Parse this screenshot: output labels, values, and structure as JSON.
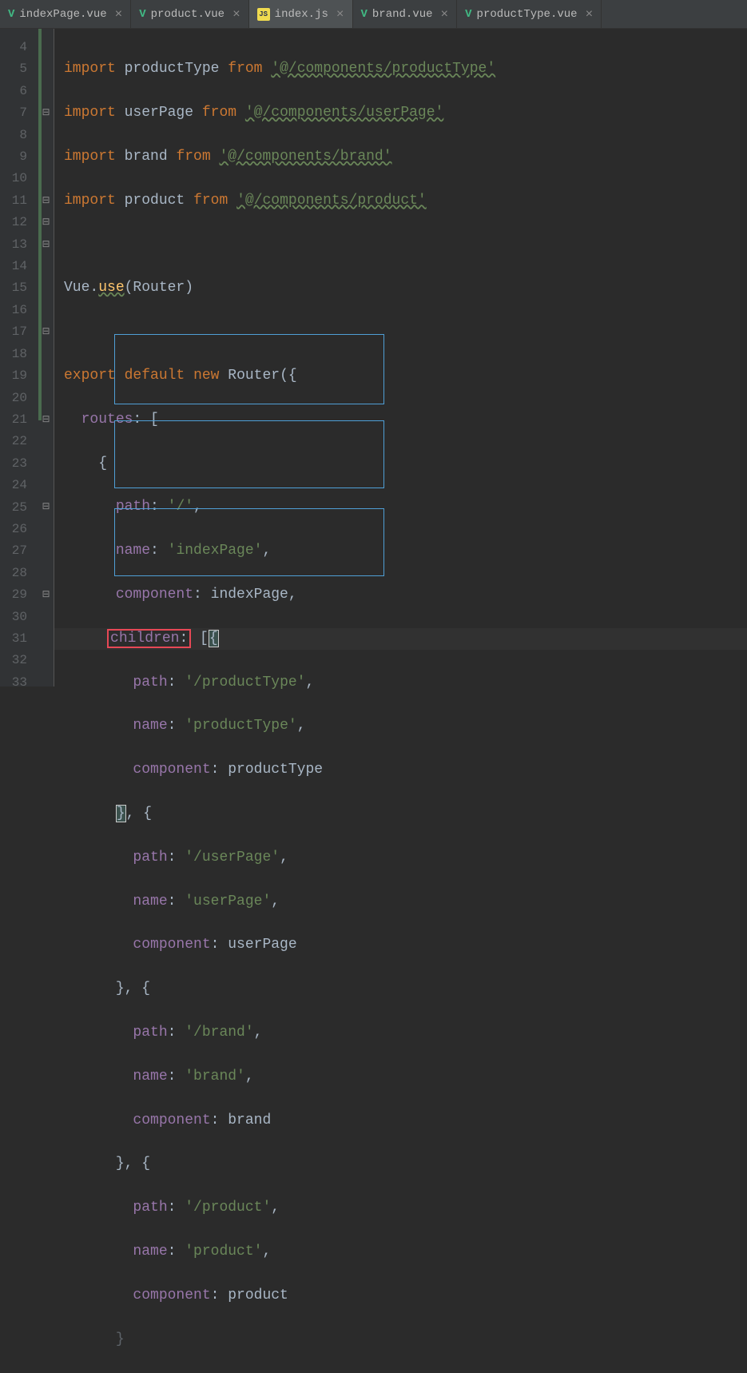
{
  "tabs": [
    {
      "icon": "vue",
      "label": "indexPage.vue",
      "active": false
    },
    {
      "icon": "vue",
      "label": "product.vue",
      "active": false
    },
    {
      "icon": "js",
      "label": "index.js",
      "active": true
    },
    {
      "icon": "vue",
      "label": "brand.vue",
      "active": false
    },
    {
      "icon": "vue",
      "label": "productType.vue",
      "active": false
    }
  ],
  "lineStart": 4,
  "lineEnd": 33,
  "code": {
    "l4": {
      "kw1": "import",
      "id": "productType",
      "kw2": "from",
      "str": "'@/components/productType'"
    },
    "l5": {
      "kw1": "import",
      "id": "userPage",
      "kw2": "from",
      "str": "'@/components/userPage'"
    },
    "l6": {
      "kw1": "import",
      "id": "brand",
      "kw2": "from",
      "str": "'@/components/brand'"
    },
    "l7": {
      "kw1": "import",
      "id": "product",
      "kw2": "from",
      "str": "'@/components/product'"
    },
    "l9": {
      "pre": "Vue.",
      "fn": "use",
      "post": "(Router)"
    },
    "l11": {
      "kw1": "export",
      "kw2": "default",
      "kw3": "new",
      "cls": "Router",
      "post": "({"
    },
    "l12": {
      "prop": "routes",
      "post": ": ["
    },
    "l14": {
      "prop": "path",
      "str": "'/'"
    },
    "l15": {
      "prop": "name",
      "str": "'indexPage'"
    },
    "l16": {
      "prop": "component",
      "id": "indexPage"
    },
    "l17": {
      "prop": "children",
      "post": ": [{"
    },
    "l18": {
      "prop": "path",
      "str": "'/productType'"
    },
    "l19": {
      "prop": "name",
      "str": "'productType'"
    },
    "l20": {
      "prop": "component",
      "id": "productType"
    },
    "l22": {
      "prop": "path",
      "str": "'/userPage'"
    },
    "l23": {
      "prop": "name",
      "str": "'userPage'"
    },
    "l24": {
      "prop": "component",
      "id": "userPage"
    },
    "l26": {
      "prop": "path",
      "str": "'/brand'"
    },
    "l27": {
      "prop": "name",
      "str": "'brand'"
    },
    "l28": {
      "prop": "component",
      "id": "brand"
    },
    "l30": {
      "prop": "path",
      "str": "'/product'"
    },
    "l31": {
      "prop": "name",
      "str": "'product'"
    },
    "l32": {
      "prop": "component",
      "id": "product"
    },
    "braceOpen": "{",
    "braceCloseComma": "}, {",
    "braceClose": "}",
    "comma": ","
  }
}
